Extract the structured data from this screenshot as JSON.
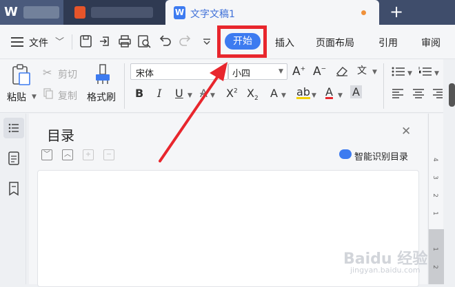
{
  "tabs": {
    "doc_title": "文字文稿1",
    "new_tab": "+",
    "logo_text": "W"
  },
  "menu": {
    "file": "文件",
    "active_tab": "开始",
    "tabs": [
      "插入",
      "页面布局",
      "引用",
      "审阅"
    ]
  },
  "ribbon": {
    "paste": "粘贴",
    "cut": "剪切",
    "copy": "复制",
    "format_painter": "格式刷",
    "font_name": "宋体",
    "font_size": "小四"
  },
  "toc": {
    "title": "目录",
    "smart_detect": "智能识别目录"
  },
  "ruler": {
    "numbers": [
      "4",
      "3",
      "2",
      "1",
      "1",
      "2"
    ]
  },
  "watermark": {
    "brand": "Baidu 经验",
    "url": "jingyan.baidu.com"
  },
  "colors": {
    "accent": "#3d7bf0",
    "highlight_box": "#e8262d",
    "annotation_arrow": "#e8262d"
  }
}
